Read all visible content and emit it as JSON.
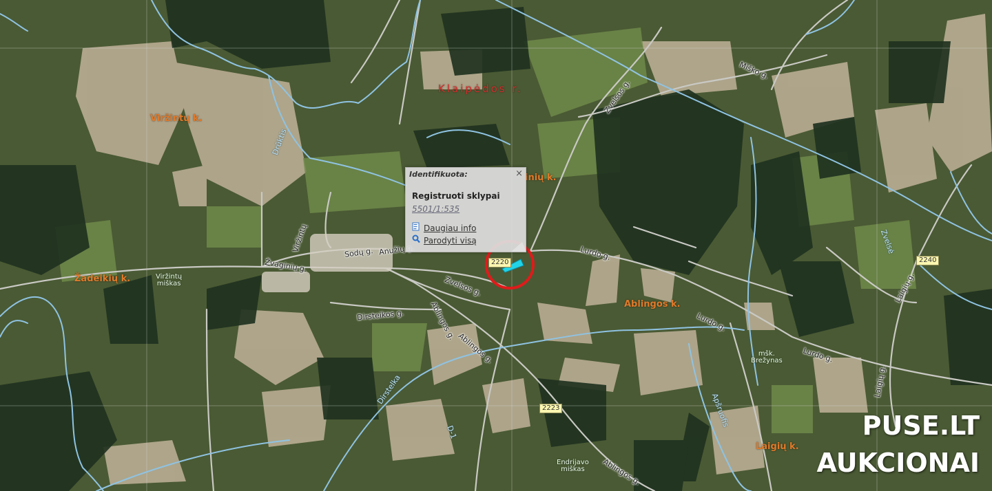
{
  "district_label": "Klaipėdos r.",
  "villages": {
    "virzintu": "Viržintų k.",
    "zadeikiu": "Žadeikių k.",
    "ablingos": "Ablingos k.",
    "laigiu": "Laigių k.",
    "partial_inius": "inių k."
  },
  "streets": {
    "sodu": "Sodų g.",
    "anuziu": "Anužių g.",
    "virzintu": "Viržintų",
    "zvaginiu": "Žvaginių g.",
    "zvelsos1": "Zvelsos g.",
    "zvelsos2": "Zvelsos g.",
    "dirsteikos": "Dirsteikos g.",
    "ablingos1": "Ablingos g.",
    "ablingos2": "Ablingos g.",
    "ablingos3": "Ablingos g.",
    "lurdo1": "Lurdo g.",
    "lurdo2": "Lurdo g.",
    "lurdo3": "Lurdo g.",
    "misko": "Miško g.",
    "laigiu": "Laigių g.",
    "laigiu2": "Laigių g."
  },
  "rivers": {
    "drukis": "Drūktis",
    "dirstelka": "Dirstelka",
    "apsruofis": "Apšruofis",
    "zvelse": "Zvelsė",
    "d1": "D-1"
  },
  "forests": {
    "virzintu": [
      "Viržintų",
      "miškas"
    ],
    "brezyno": [
      "mšk.",
      "Brežynas"
    ],
    "endrijavo": [
      "Endrijavo",
      "miškas"
    ]
  },
  "road_numbers": {
    "r2223": "2223",
    "r2240": "2240",
    "r2220": "2220"
  },
  "popup": {
    "title": "Identifikuota:",
    "close_icon": "×",
    "layer_name": "Registruoti sklypai",
    "parcel_code": "5501/1:535",
    "more_info_label": "Daugiau info",
    "show_all_label": "Parodyti visą"
  },
  "highlight": {
    "circle_color": "#e01b1b",
    "parcel_color": "#22d3e6"
  },
  "watermark": {
    "line1": "PUSE.LT",
    "line2": "AUKCIONAI"
  }
}
